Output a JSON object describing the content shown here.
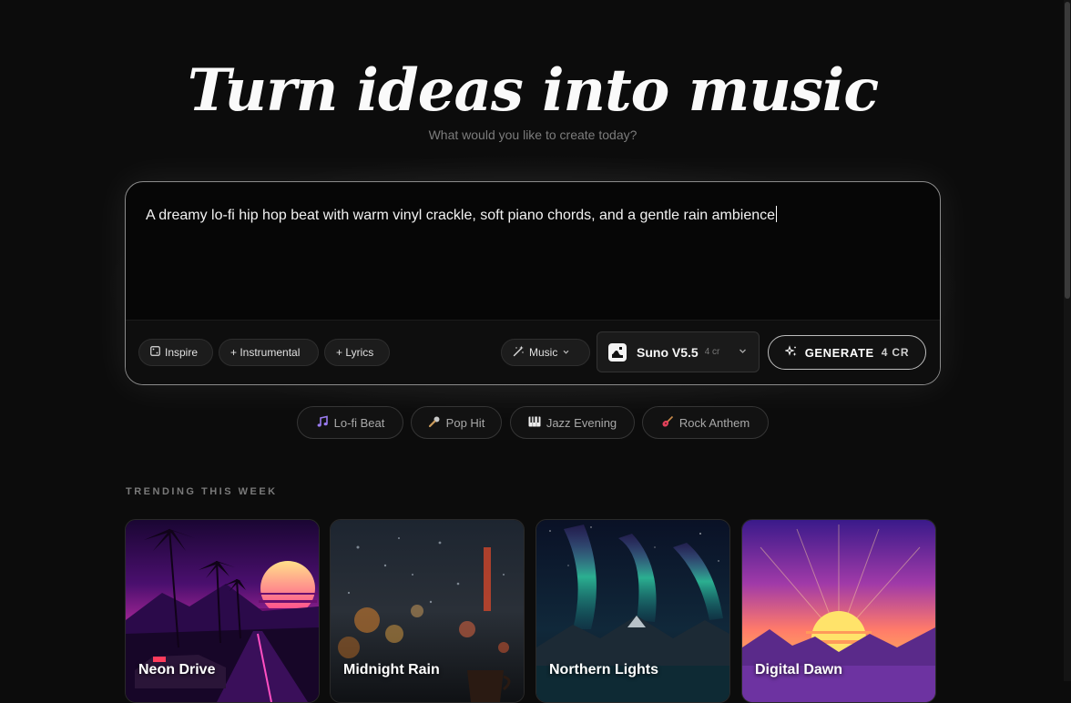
{
  "hero": {
    "title": "Turn ideas into music",
    "subtitle": "What would you like to create today?"
  },
  "composer": {
    "prompt_text": "A dreamy lo-fi hip hop beat with warm vinyl crackle, soft piano chords, and a gentle rain ambience",
    "inspire_label": "Inspire",
    "instrumental_label": "+ Instrumental",
    "lyrics_label": "+ Lyrics",
    "mode_label": "Music",
    "model": {
      "name": "Suno V5.5",
      "cost": "4 cr"
    },
    "generate": {
      "label": "GENERATE",
      "cost": "4 CR"
    }
  },
  "presets": [
    {
      "label": "Lo-fi Beat",
      "icon": "music-note-icon"
    },
    {
      "label": "Pop Hit",
      "icon": "microphone-icon"
    },
    {
      "label": "Jazz Evening",
      "icon": "piano-icon"
    },
    {
      "label": "Rock Anthem",
      "icon": "guitar-icon"
    }
  ],
  "trending": {
    "heading": "TRENDING THIS WEEK",
    "cards": [
      {
        "title": "Neon Drive"
      },
      {
        "title": "Midnight Rain"
      },
      {
        "title": "Northern Lights"
      },
      {
        "title": "Digital Dawn"
      }
    ]
  }
}
